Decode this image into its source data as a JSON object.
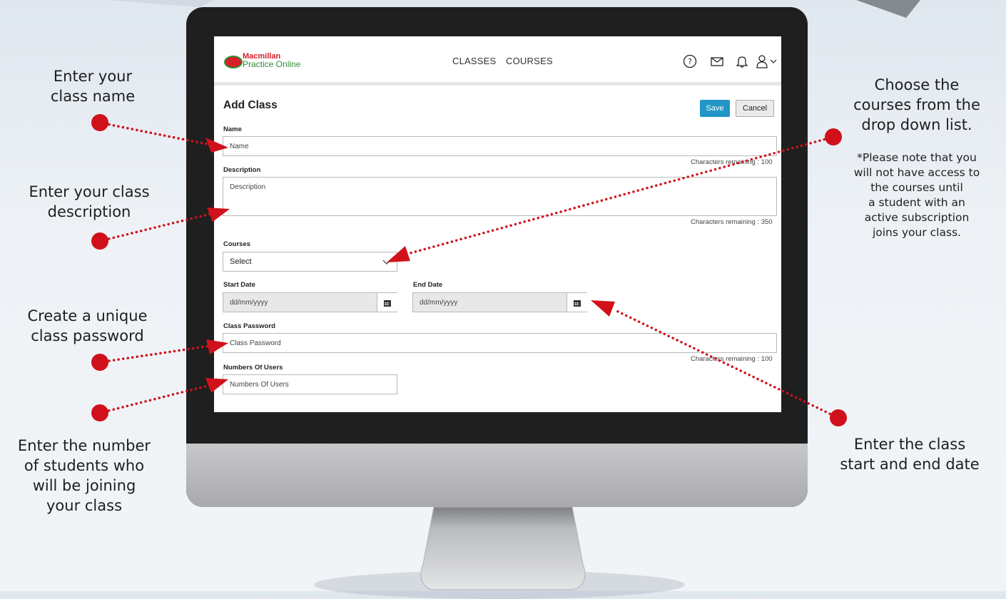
{
  "callouts": {
    "class_name": [
      "Enter your",
      "class name"
    ],
    "class_description": [
      "Enter your class",
      "description"
    ],
    "class_password": [
      "Create a unique",
      "class password"
    ],
    "number_of_students": [
      "Enter the number",
      "of students who",
      "will be joining",
      "your class"
    ],
    "courses": [
      "Choose the",
      "courses from the",
      "drop down list."
    ],
    "courses_note": [
      "*Please note that you",
      "will not have access to",
      "the courses until",
      "a student with an",
      "active subscription",
      "joins your class."
    ],
    "dates": [
      "Enter the class",
      "start and end date"
    ]
  },
  "app": {
    "logo_line1": "Macmillan",
    "logo_line2": "Practice Online",
    "nav": {
      "classes": "CLASSES",
      "courses": "COURSES"
    }
  },
  "form": {
    "title": "Add Class",
    "save_label": "Save",
    "cancel_label": "Cancel",
    "name": {
      "label": "Name",
      "placeholder": "Name",
      "remaining": "Characters remaining : 100"
    },
    "description": {
      "label": "Description",
      "placeholder": "Description",
      "remaining": "Characters remaining : 350"
    },
    "courses": {
      "label": "Courses",
      "selected": "Select"
    },
    "start_date": {
      "label": "Start Date",
      "placeholder": "dd/mm/yyyy"
    },
    "end_date": {
      "label": "End Date",
      "placeholder": "dd/mm/yyyy"
    },
    "password": {
      "label": "Class Password",
      "placeholder": "Class Password",
      "remaining": "Characters remaining : 100"
    },
    "users": {
      "label": "Numbers Of Users",
      "placeholder": "Numbers Of Users"
    }
  },
  "colors": {
    "accent": "#2196c7",
    "callout_red": "#d0111b",
    "logo_red": "#d6202a",
    "logo_green": "#2f8f35"
  }
}
